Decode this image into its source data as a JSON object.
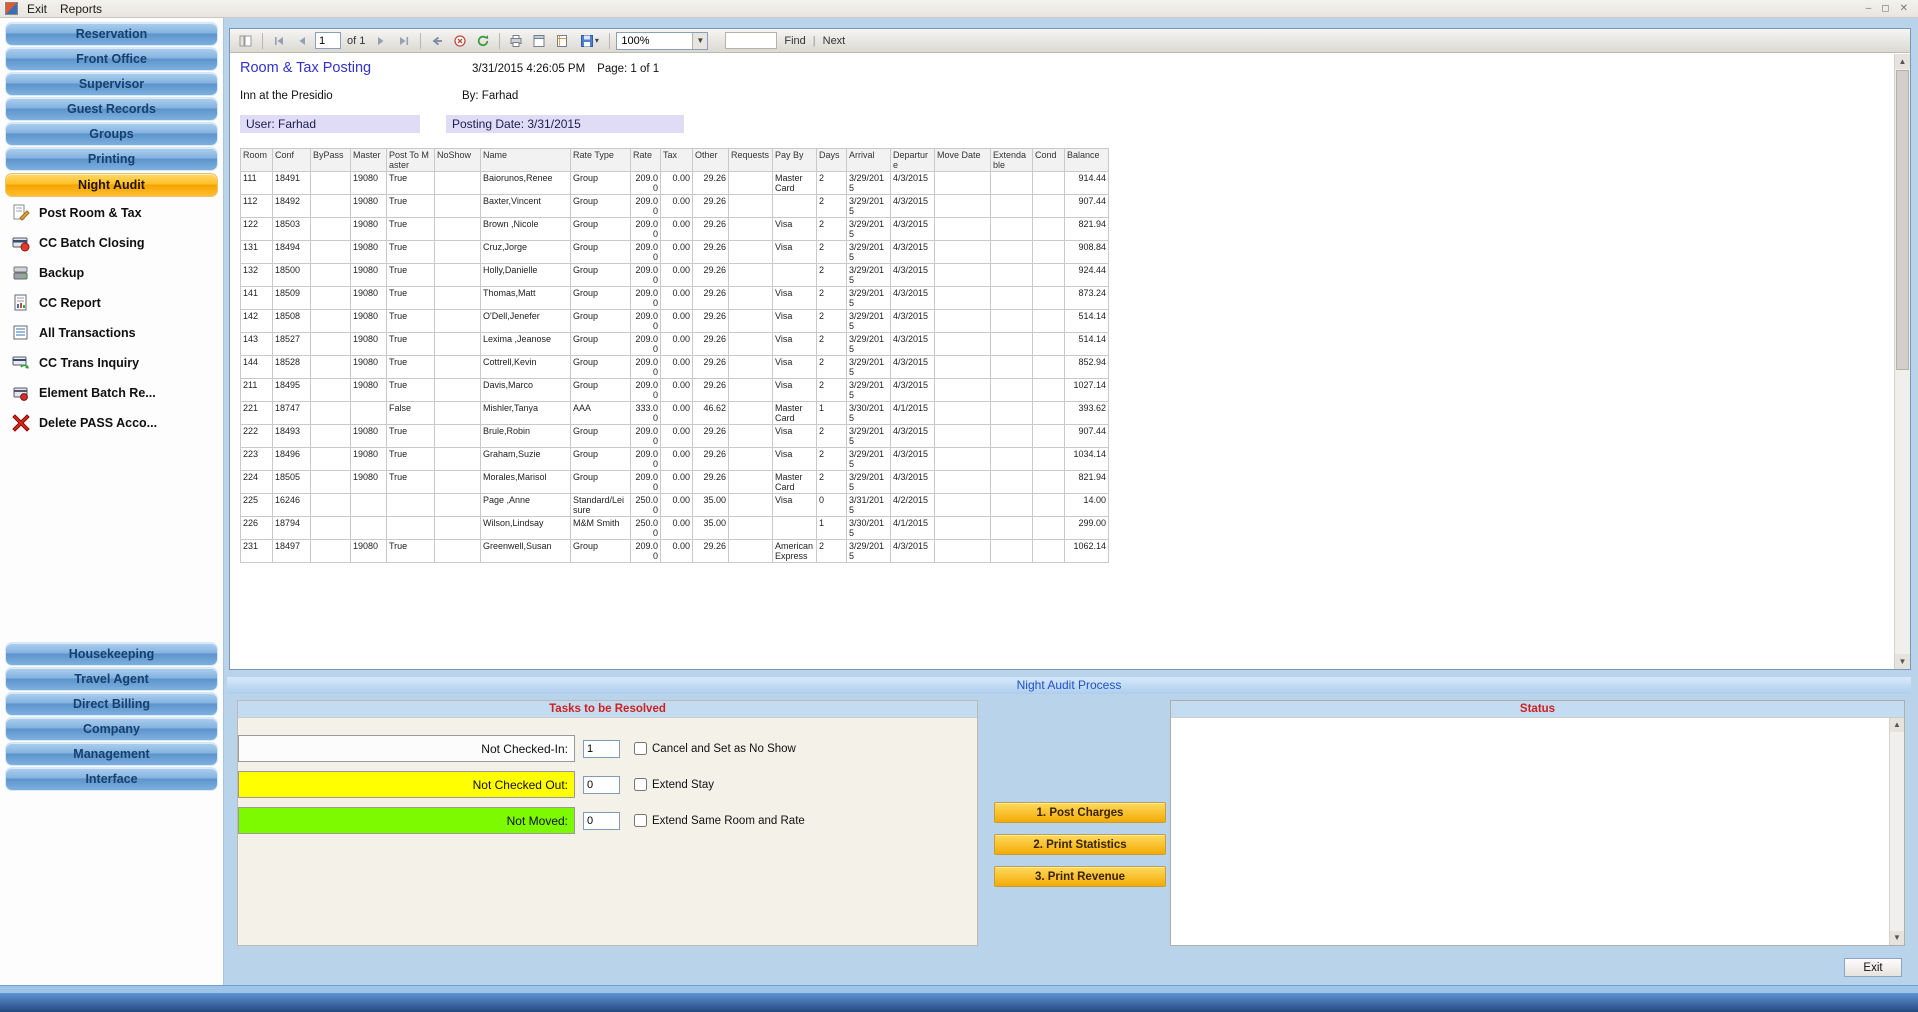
{
  "window": {
    "menu_items": [
      "Exit",
      "Reports"
    ]
  },
  "sidebar": {
    "top_items": [
      "Reservation",
      "Front Office",
      "Supervisor",
      "Guest Records",
      "Groups",
      "Printing"
    ],
    "active_item": "Night Audit",
    "tools": [
      {
        "label": "Post Room & Tax",
        "icon": "post-room-tax-icon"
      },
      {
        "label": "CC Batch Closing",
        "icon": "cc-batch-closing-icon"
      },
      {
        "label": "Backup",
        "icon": "backup-icon"
      },
      {
        "label": "CC Report",
        "icon": "cc-report-icon"
      },
      {
        "label": "All Transactions",
        "icon": "all-transactions-icon"
      },
      {
        "label": "CC Trans Inquiry",
        "icon": "cc-trans-inquiry-icon"
      },
      {
        "label": "Element Batch Re...",
        "icon": "element-batch-icon"
      },
      {
        "label": "Delete PASS Acco...",
        "icon": "delete-pass-icon"
      }
    ],
    "bottom_items": [
      "Housekeeping",
      "Travel Agent",
      "Direct Billing",
      "Company",
      "Management",
      "Interface"
    ]
  },
  "toolbar": {
    "page_value": "1",
    "of_label": "of 1",
    "zoom_value": "100%",
    "find_label": "Find",
    "next_label": "Next"
  },
  "report": {
    "title": "Room & Tax Posting",
    "datetime": "3/31/2015 4:26:05 PM",
    "page_label": "Page: 1 of 1",
    "property": "Inn at the Presidio",
    "by": "By: Farhad",
    "user": "User: Farhad",
    "posting_date": "Posting Date: 3/31/2015",
    "columns": [
      "Room",
      "Conf",
      "ByPass",
      "Master",
      "Post To Master",
      "NoShow",
      "Name",
      "Rate Type",
      "Rate",
      "Tax",
      "Other",
      "Requests",
      "Pay By",
      "Days",
      "Arrival",
      "Departure",
      "Move Date",
      "Extendable",
      "Cond",
      "Balance"
    ],
    "rows": [
      [
        "111",
        "18491",
        "",
        "19080",
        "True",
        "",
        "Baiorunos,Renee",
        "Group",
        "209.00",
        "0.00",
        "29.26",
        "",
        "Master Card",
        "2",
        "3/29/2015",
        "4/3/2015",
        "",
        "",
        "",
        "914.44"
      ],
      [
        "112",
        "18492",
        "",
        "19080",
        "True",
        "",
        "Baxter,Vincent",
        "Group",
        "209.00",
        "0.00",
        "29.26",
        "",
        "",
        "2",
        "3/29/2015",
        "4/3/2015",
        "",
        "",
        "",
        "907.44"
      ],
      [
        "122",
        "18503",
        "",
        "19080",
        "True",
        "",
        "Brown ,Nicole",
        "Group",
        "209.00",
        "0.00",
        "29.26",
        "",
        "Visa",
        "2",
        "3/29/2015",
        "4/3/2015",
        "",
        "",
        "",
        "821.94"
      ],
      [
        "131",
        "18494",
        "",
        "19080",
        "True",
        "",
        "Cruz,Jorge",
        "Group",
        "209.00",
        "0.00",
        "29.26",
        "",
        "Visa",
        "2",
        "3/29/2015",
        "4/3/2015",
        "",
        "",
        "",
        "908.84"
      ],
      [
        "132",
        "18500",
        "",
        "19080",
        "True",
        "",
        "Holly,Danielle",
        "Group",
        "209.00",
        "0.00",
        "29.26",
        "",
        "",
        "2",
        "3/29/2015",
        "4/3/2015",
        "",
        "",
        "",
        "924.44"
      ],
      [
        "141",
        "18509",
        "",
        "19080",
        "True",
        "",
        "Thomas,Matt",
        "Group",
        "209.00",
        "0.00",
        "29.26",
        "",
        "Visa",
        "2",
        "3/29/2015",
        "4/3/2015",
        "",
        "",
        "",
        "873.24"
      ],
      [
        "142",
        "18508",
        "",
        "19080",
        "True",
        "",
        "O'Dell,Jenefer",
        "Group",
        "209.00",
        "0.00",
        "29.26",
        "",
        "Visa",
        "2",
        "3/29/2015",
        "4/3/2015",
        "",
        "",
        "",
        "514.14"
      ],
      [
        "143",
        "18527",
        "",
        "19080",
        "True",
        "",
        "Lexima ,Jeanose",
        "Group",
        "209.00",
        "0.00",
        "29.26",
        "",
        "Visa",
        "2",
        "3/29/2015",
        "4/3/2015",
        "",
        "",
        "",
        "514.14"
      ],
      [
        "144",
        "18528",
        "",
        "19080",
        "True",
        "",
        "Cottrell,Kevin",
        "Group",
        "209.00",
        "0.00",
        "29.26",
        "",
        "Visa",
        "2",
        "3/29/2015",
        "4/3/2015",
        "",
        "",
        "",
        "852.94"
      ],
      [
        "211",
        "18495",
        "",
        "19080",
        "True",
        "",
        "Davis,Marco",
        "Group",
        "209.00",
        "0.00",
        "29.26",
        "",
        "Visa",
        "2",
        "3/29/2015",
        "4/3/2015",
        "",
        "",
        "",
        "1027.14"
      ],
      [
        "221",
        "18747",
        "",
        "",
        "False",
        "",
        "Mishler,Tanya",
        "AAA",
        "333.00",
        "0.00",
        "46.62",
        "",
        "Master Card",
        "1",
        "3/30/2015",
        "4/1/2015",
        "",
        "",
        "",
        "393.62"
      ],
      [
        "222",
        "18493",
        "",
        "19080",
        "True",
        "",
        "Brule,Robin",
        "Group",
        "209.00",
        "0.00",
        "29.26",
        "",
        "Visa",
        "2",
        "3/29/2015",
        "4/3/2015",
        "",
        "",
        "",
        "907.44"
      ],
      [
        "223",
        "18496",
        "",
        "19080",
        "True",
        "",
        "Graham,Suzie",
        "Group",
        "209.00",
        "0.00",
        "29.26",
        "",
        "Visa",
        "2",
        "3/29/2015",
        "4/3/2015",
        "",
        "",
        "",
        "1034.14"
      ],
      [
        "224",
        "18505",
        "",
        "19080",
        "True",
        "",
        "Morales,Marisol",
        "Group",
        "209.00",
        "0.00",
        "29.26",
        "",
        "Master Card",
        "2",
        "3/29/2015",
        "4/3/2015",
        "",
        "",
        "",
        "821.94"
      ],
      [
        "225",
        "16246",
        "",
        "",
        "",
        "",
        "Page ,Anne",
        "Standard/Leisure",
        "250.00",
        "0.00",
        "35.00",
        "",
        "Visa",
        "0",
        "3/31/2015",
        "4/2/2015",
        "",
        "",
        "",
        "14.00"
      ],
      [
        "226",
        "18794",
        "",
        "",
        "",
        "",
        "Wilson,Lindsay",
        "M&M Smith",
        "250.00",
        "0.00",
        "35.00",
        "",
        "",
        "1",
        "3/30/2015",
        "4/1/2015",
        "",
        "",
        "",
        "299.00"
      ],
      [
        "231",
        "18497",
        "",
        "19080",
        "True",
        "",
        "Greenwell,Susan",
        "Group",
        "209.00",
        "0.00",
        "29.26",
        "",
        "American Express",
        "2",
        "3/29/2015",
        "4/3/2015",
        "",
        "",
        "",
        "1062.14"
      ]
    ]
  },
  "process": {
    "header": "Night Audit Process",
    "tasks_header": "Tasks to be Resolved",
    "status_header": "Status",
    "tasks": [
      {
        "label": "Not Checked-In:",
        "value": "1",
        "option": "Cancel and Set as No Show"
      },
      {
        "label": "Not Checked Out:",
        "value": "0",
        "option": "Extend Stay"
      },
      {
        "label": "Not Moved:",
        "value": "0",
        "option": "Extend Same Room and Rate"
      }
    ],
    "action_buttons": [
      "1. Post Charges",
      "2. Print Statistics",
      "3. Print Revenue"
    ],
    "exit_label": "Exit"
  },
  "colors": {
    "active_nav": "#f5a400",
    "not_checked_out_row": "#ffff00",
    "not_moved_row": "#7dfa00",
    "panel_header_text": "#d02020",
    "action_button": "#f3ab07",
    "highlight_box": "#e0dcf6"
  }
}
